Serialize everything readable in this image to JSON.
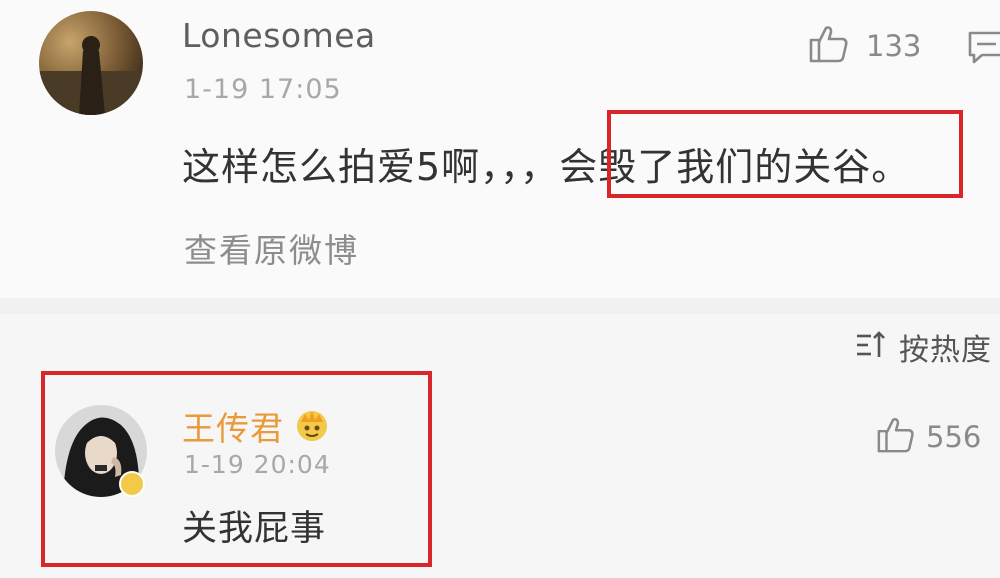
{
  "post": {
    "username": "Lonesomea",
    "timestamp": "1-19 17:05",
    "like_count": "133",
    "comment_prefix": "这样怎么拍爱5啊，，，",
    "comment_highlight": "会毁了我们的关谷。",
    "view_original": "查看原微博"
  },
  "sort": {
    "label": "按热度"
  },
  "reply": {
    "username": "王传君",
    "timestamp": "1-19 20:04",
    "text": "关我屁事",
    "like_count": "556"
  },
  "colors": {
    "highlight_border": "#d9262b",
    "reply_username": "#e99a3a",
    "badge": "#f3c94a"
  }
}
